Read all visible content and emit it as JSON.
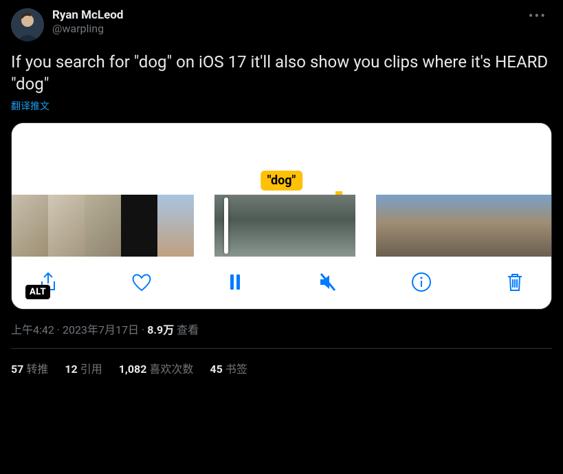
{
  "author": {
    "display_name": "Ryan McLeod",
    "handle": "@warpling"
  },
  "tweet_text": "If you search for \"dog\" on iOS 17 it'll also show you clips where it's HEARD \"dog\"",
  "translate_label": "翻译推文",
  "media": {
    "search_term_label": "\"dog\"",
    "alt_badge": "ALT"
  },
  "meta": {
    "time": "上午4:42",
    "date": "2023年7月17日",
    "views_count": "8.9万",
    "views_label": "查看"
  },
  "stats": {
    "retweets": {
      "count": "57",
      "label": "转推"
    },
    "quotes": {
      "count": "12",
      "label": "引用"
    },
    "likes": {
      "count": "1,082",
      "label": "喜欢次数"
    },
    "bookmarks": {
      "count": "45",
      "label": "书签"
    }
  }
}
